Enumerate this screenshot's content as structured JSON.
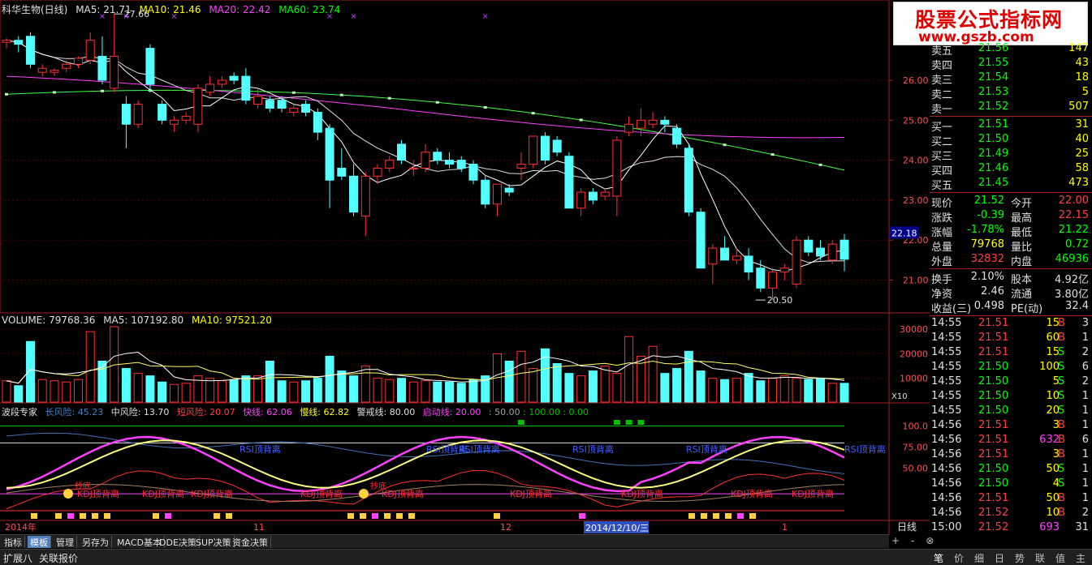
{
  "header": {
    "stock": "科华生物(日线)",
    "ma5": "MA5: 21.71",
    "ma10": "MA10: 21.46",
    "ma20": "MA20: 22.42",
    "ma60": "MA60: 23.74"
  },
  "price_axis": [
    "26.00",
    "25.00",
    "24.00",
    "23.00",
    "22.00",
    "21.00"
  ],
  "current_price_tag": "22.18",
  "annotations": {
    "high": "27.66",
    "low": "20.50"
  },
  "volume_header": {
    "volume": "VOLUME: 79768.36",
    "ma5": "MA5: 107192.80",
    "ma10": "MA10: 97521.20"
  },
  "volume_axis": [
    "30000",
    "20000",
    "10000"
  ],
  "volume_unit": "X10",
  "indicator_header": {
    "name": "波段专家",
    "long_risk": "长风险: 45.23",
    "mid_risk": "中风险: 13.70",
    "short_risk": "短风险: 20.07",
    "fast_line": "快线: 62.06",
    "slow_line": "慢线: 62.82",
    "alert_line": "警戒线: 80.00",
    "start_line": "启动线: 20.00",
    "extra1": ": 50.00",
    "extra2": ": 100.00",
    "extra3": ": 0.00"
  },
  "indicator_axis": [
    "100.0",
    "75.00",
    "50.00"
  ],
  "indicator_labels": {
    "rsi": [
      "RSI顶背离",
      "RSI顶背离",
      "RSI顶背离",
      "RSI顶背离",
      "RSI顶背离",
      "RSI顶背离"
    ],
    "kdj": [
      "KDJ顶背离",
      "KDJ顶背离",
      "KDJ顶背离",
      "KDJ顶背离",
      "KDJ顶背离",
      "KDJ顶背离",
      "KDJ顶背离",
      "KDJ顶背离",
      "KDJ顶背离"
    ],
    "buy": [
      "抄底",
      "抄底"
    ]
  },
  "date_axis": {
    "year": "2014年",
    "m11": "11",
    "m12": "12",
    "m1": "1",
    "cursor": "2014/12/10/三",
    "period": "日线"
  },
  "tabs": [
    "指标",
    "模板",
    "管理",
    "另存为",
    "MACD基本",
    "DDE决策",
    "SUP决策",
    "资金决策"
  ],
  "bottom_left": [
    "扩展八",
    "关联报价"
  ],
  "bottom_right": [
    "笔",
    "价",
    "细",
    "日",
    "势",
    "联",
    "值",
    "主"
  ],
  "logo": {
    "title": "股票公式指标网",
    "url": "www.gszb.com"
  },
  "order_book": {
    "sell": [
      {
        "label": "卖五",
        "price": "21.56",
        "vol": "147"
      },
      {
        "label": "卖四",
        "price": "21.55",
        "vol": "43"
      },
      {
        "label": "卖三",
        "price": "21.54",
        "vol": "18"
      },
      {
        "label": "卖二",
        "price": "21.53",
        "vol": "5"
      },
      {
        "label": "卖一",
        "price": "21.52",
        "vol": "507"
      }
    ],
    "buy": [
      {
        "label": "买一",
        "price": "21.51",
        "vol": "31"
      },
      {
        "label": "买二",
        "price": "21.50",
        "vol": "40"
      },
      {
        "label": "买三",
        "price": "21.49",
        "vol": "25"
      },
      {
        "label": "买四",
        "price": "21.46",
        "vol": "58"
      },
      {
        "label": "买五",
        "price": "21.45",
        "vol": "473"
      }
    ]
  },
  "quote": {
    "now_l": "现价",
    "now_v": "21.52",
    "open_l": "今开",
    "open_v": "22.00",
    "chg_l": "涨跌",
    "chg_v": "-0.39",
    "high_l": "最高",
    "high_v": "22.15",
    "pct_l": "涨幅",
    "pct_v": "-1.78%",
    "low_l": "最低",
    "low_v": "21.22",
    "vol_l": "总量",
    "vol_v": "79768",
    "ratio_l": "量比",
    "ratio_v": "0.72",
    "out_l": "外盘",
    "out_v": "32832",
    "in_l": "内盘",
    "in_v": "46936",
    "turn_l": "换手",
    "turn_v": "2.10%",
    "cap_l": "股本",
    "cap_v": "4.92亿",
    "na_l": "净资",
    "na_v": "2.46",
    "float_l": "流通",
    "float_v": "3.80亿",
    "eps_l": "收益(三)",
    "eps_v": "0.498",
    "pe_l": "PE(动)",
    "pe_v": "32.4"
  },
  "ticks": [
    {
      "t": "14:55",
      "p": "21.51",
      "v": "15",
      "s": "B",
      "n": "3"
    },
    {
      "t": "14:55",
      "p": "21.51",
      "v": "60",
      "s": "B",
      "n": "1"
    },
    {
      "t": "14:55",
      "p": "21.51",
      "v": "15",
      "s": "S",
      "n": "2"
    },
    {
      "t": "14:55",
      "p": "21.50",
      "v": "100",
      "s": "S",
      "n": "6"
    },
    {
      "t": "14:55",
      "p": "21.50",
      "v": "5",
      "s": "S",
      "n": "2"
    },
    {
      "t": "14:55",
      "p": "21.50",
      "v": "10",
      "s": "S",
      "n": "1"
    },
    {
      "t": "14:55",
      "p": "21.50",
      "v": "20",
      "s": "S",
      "n": "1"
    },
    {
      "t": "14:56",
      "p": "21.51",
      "v": "3",
      "s": "B",
      "n": "1"
    },
    {
      "t": "14:56",
      "p": "21.51",
      "v": "632",
      "s": "B",
      "n": "6"
    },
    {
      "t": "14:56",
      "p": "21.51",
      "v": "3",
      "s": "B",
      "n": "1"
    },
    {
      "t": "14:56",
      "p": "21.50",
      "v": "50",
      "s": "S",
      "n": "1"
    },
    {
      "t": "14:56",
      "p": "21.50",
      "v": "4",
      "s": "S",
      "n": "1"
    },
    {
      "t": "14:56",
      "p": "21.51",
      "v": "50",
      "s": "B",
      "n": "1"
    },
    {
      "t": "14:56",
      "p": "21.52",
      "v": "10",
      "s": "B",
      "n": "2"
    },
    {
      "t": "15:00",
      "p": "21.52",
      "v": "693",
      "s": "",
      "n": "31"
    }
  ],
  "colors": {
    "up": "#ff3030",
    "down": "#54ffff",
    "ma5": "#ffffff",
    "ma10": "#ffff66",
    "ma20": "#ff40ff",
    "ma60": "#40ff40"
  },
  "candles": [
    {
      "o": 26.95,
      "h": 27.05,
      "l": 26.8,
      "c": 27.0
    },
    {
      "o": 27.0,
      "h": 27.1,
      "l": 26.7,
      "c": 26.9
    },
    {
      "o": 27.1,
      "h": 27.2,
      "l": 26.3,
      "c": 26.4
    },
    {
      "o": 26.2,
      "h": 26.4,
      "l": 26.1,
      "c": 26.3
    },
    {
      "o": 26.2,
      "h": 26.3,
      "l": 26.1,
      "c": 26.25
    },
    {
      "o": 26.3,
      "h": 26.5,
      "l": 26.2,
      "c": 26.4
    },
    {
      "o": 26.4,
      "h": 26.6,
      "l": 26.3,
      "c": 26.55
    },
    {
      "o": 26.5,
      "h": 27.2,
      "l": 26.4,
      "c": 27.0
    },
    {
      "o": 26.6,
      "h": 27.1,
      "l": 25.9,
      "c": 26.0
    },
    {
      "o": 25.8,
      "h": 27.66,
      "l": 25.7,
      "c": 26.6
    },
    {
      "o": 25.4,
      "h": 25.6,
      "l": 24.3,
      "c": 24.9
    },
    {
      "o": 24.9,
      "h": 25.5,
      "l": 24.8,
      "c": 25.4
    },
    {
      "o": 26.8,
      "h": 26.9,
      "l": 25.7,
      "c": 25.9
    },
    {
      "o": 25.4,
      "h": 25.5,
      "l": 24.9,
      "c": 25.0
    },
    {
      "o": 24.9,
      "h": 25.1,
      "l": 24.7,
      "c": 25.0
    },
    {
      "o": 25.0,
      "h": 25.2,
      "l": 24.9,
      "c": 25.1
    },
    {
      "o": 24.9,
      "h": 25.9,
      "l": 24.7,
      "c": 25.8
    },
    {
      "o": 25.7,
      "h": 26.1,
      "l": 25.6,
      "c": 25.9
    },
    {
      "o": 25.9,
      "h": 26.1,
      "l": 25.8,
      "c": 26.0
    },
    {
      "o": 26.1,
      "h": 26.2,
      "l": 25.9,
      "c": 26.0
    },
    {
      "o": 26.1,
      "h": 26.3,
      "l": 25.4,
      "c": 25.5
    },
    {
      "o": 25.4,
      "h": 25.8,
      "l": 25.3,
      "c": 25.6
    },
    {
      "o": 25.5,
      "h": 25.6,
      "l": 25.2,
      "c": 25.3
    },
    {
      "o": 25.5,
      "h": 25.6,
      "l": 25.2,
      "c": 25.3
    },
    {
      "o": 25.2,
      "h": 25.4,
      "l": 25.1,
      "c": 25.3
    },
    {
      "o": 25.4,
      "h": 25.5,
      "l": 25.1,
      "c": 25.2
    },
    {
      "o": 25.2,
      "h": 25.3,
      "l": 24.5,
      "c": 24.7
    },
    {
      "o": 24.8,
      "h": 24.9,
      "l": 22.8,
      "c": 23.5
    },
    {
      "o": 23.8,
      "h": 24.3,
      "l": 23.5,
      "c": 23.6
    },
    {
      "o": 23.6,
      "h": 23.9,
      "l": 22.6,
      "c": 22.7
    },
    {
      "o": 22.6,
      "h": 23.7,
      "l": 22.1,
      "c": 23.6
    },
    {
      "o": 23.6,
      "h": 23.9,
      "l": 23.4,
      "c": 23.8
    },
    {
      "o": 23.8,
      "h": 24.1,
      "l": 23.7,
      "c": 24.0
    },
    {
      "o": 24.4,
      "h": 24.5,
      "l": 23.9,
      "c": 24.0
    },
    {
      "o": 23.8,
      "h": 24.0,
      "l": 23.6,
      "c": 23.8
    },
    {
      "o": 23.8,
      "h": 24.4,
      "l": 23.7,
      "c": 24.2
    },
    {
      "o": 24.2,
      "h": 24.3,
      "l": 23.9,
      "c": 24.0
    },
    {
      "o": 24.0,
      "h": 24.2,
      "l": 23.8,
      "c": 23.9
    },
    {
      "o": 24.0,
      "h": 24.1,
      "l": 23.7,
      "c": 23.8
    },
    {
      "o": 23.9,
      "h": 24.0,
      "l": 23.4,
      "c": 23.5
    },
    {
      "o": 23.5,
      "h": 23.6,
      "l": 22.8,
      "c": 22.9
    },
    {
      "o": 22.9,
      "h": 23.4,
      "l": 22.6,
      "c": 23.4
    },
    {
      "o": 23.3,
      "h": 23.4,
      "l": 23.1,
      "c": 23.2
    },
    {
      "o": 23.8,
      "h": 24.2,
      "l": 23.5,
      "c": 23.9
    },
    {
      "o": 23.9,
      "h": 24.6,
      "l": 23.8,
      "c": 24.6
    },
    {
      "o": 24.6,
      "h": 24.7,
      "l": 23.9,
      "c": 24.0
    },
    {
      "o": 24.5,
      "h": 24.6,
      "l": 24.1,
      "c": 24.2
    },
    {
      "o": 24.1,
      "h": 24.2,
      "l": 22.8,
      "c": 22.8
    },
    {
      "o": 22.8,
      "h": 23.3,
      "l": 22.6,
      "c": 23.2
    },
    {
      "o": 23.2,
      "h": 23.3,
      "l": 22.9,
      "c": 23.0
    },
    {
      "o": 23.1,
      "h": 23.3,
      "l": 23.0,
      "c": 23.2
    },
    {
      "o": 23.1,
      "h": 24.6,
      "l": 22.6,
      "c": 24.5
    },
    {
      "o": 24.7,
      "h": 25.1,
      "l": 24.6,
      "c": 24.9
    },
    {
      "o": 24.8,
      "h": 25.3,
      "l": 24.6,
      "c": 25.0
    },
    {
      "o": 24.9,
      "h": 25.2,
      "l": 24.8,
      "c": 25.0
    },
    {
      "o": 25.0,
      "h": 25.1,
      "l": 24.7,
      "c": 24.9
    },
    {
      "o": 24.8,
      "h": 24.9,
      "l": 24.3,
      "c": 24.4
    },
    {
      "o": 24.3,
      "h": 24.4,
      "l": 22.6,
      "c": 22.7
    },
    {
      "o": 22.7,
      "h": 22.8,
      "l": 21.3,
      "c": 21.3
    },
    {
      "o": 21.4,
      "h": 21.9,
      "l": 20.9,
      "c": 21.8
    },
    {
      "o": 21.8,
      "h": 22.1,
      "l": 21.7,
      "c": 21.5
    },
    {
      "o": 21.5,
      "h": 21.8,
      "l": 21.4,
      "c": 21.6
    },
    {
      "o": 21.6,
      "h": 21.8,
      "l": 21.0,
      "c": 21.2
    },
    {
      "o": 21.3,
      "h": 21.5,
      "l": 20.7,
      "c": 20.8
    },
    {
      "o": 20.8,
      "h": 21.3,
      "l": 20.5,
      "c": 21.2
    },
    {
      "o": 21.2,
      "h": 21.4,
      "l": 21.0,
      "c": 21.3
    },
    {
      "o": 20.9,
      "h": 22.1,
      "l": 20.8,
      "c": 22.0
    },
    {
      "o": 22.0,
      "h": 22.1,
      "l": 21.6,
      "c": 21.7
    },
    {
      "o": 21.8,
      "h": 22.0,
      "l": 21.5,
      "c": 21.6
    },
    {
      "o": 21.5,
      "h": 22.0,
      "l": 21.4,
      "c": 21.9
    },
    {
      "o": 22.0,
      "h": 22.15,
      "l": 21.22,
      "c": 21.52
    }
  ],
  "volumes": [
    9000,
    7000,
    25000,
    9500,
    9000,
    8500,
    9500,
    29000,
    17000,
    31000,
    14000,
    12000,
    11000,
    8500,
    7500,
    8000,
    11000,
    10000,
    9000,
    9500,
    11000,
    11000,
    17000,
    9000,
    8500,
    9000,
    10000,
    19000,
    13000,
    11000,
    15000,
    10000,
    9500,
    10000,
    8500,
    9000,
    8500,
    8500,
    8000,
    9500,
    11000,
    20000,
    17000,
    21000,
    14000,
    22000,
    16000,
    12000,
    11000,
    13000,
    15000,
    12000,
    27000,
    19000,
    23000,
    12000,
    14000,
    21000,
    13000,
    10000,
    9500,
    10000,
    12000,
    9000,
    10000,
    11000,
    10000,
    9500,
    10000,
    8000,
    7968
  ]
}
